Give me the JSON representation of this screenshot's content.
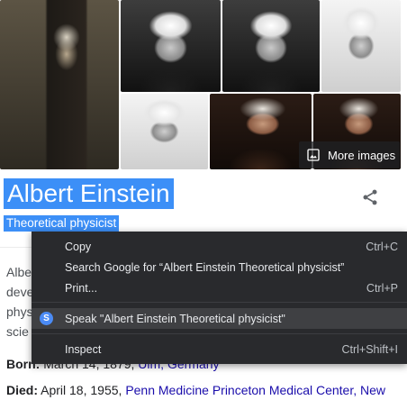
{
  "images": {
    "more_images_label": "More images",
    "more_images_icon": "image-icon"
  },
  "entity": {
    "title": "Albert Einstein",
    "subtitle": "Theoretical physicist",
    "share_icon": "share-icon"
  },
  "description": {
    "lines": [
      "Albe",
      "deve",
      "phys",
      "scie"
    ]
  },
  "facts": {
    "born": {
      "label": "Born:",
      "text": "March 14, 1879,",
      "link": "Ulm, Germany"
    },
    "died": {
      "label": "Died:",
      "text": "April 18, 1955,",
      "link": "Penn Medicine Princeton Medical Center, New"
    }
  },
  "context_menu": {
    "copy": {
      "label": "Copy",
      "shortcut": "Ctrl+C"
    },
    "search": {
      "label": "Search Google for “Albert Einstein Theoretical physicist”"
    },
    "print": {
      "label": "Print...",
      "shortcut": "Ctrl+P"
    },
    "speak": {
      "label": "Speak \"Albert Einstein Theoretical physicist\"",
      "icon": "speak-extension-icon"
    },
    "inspect": {
      "label": "Inspect",
      "shortcut": "Ctrl+Shift+I"
    }
  },
  "colors": {
    "selection": "#3c8ff7",
    "menu_bg": "#292a2d",
    "link": "#1a0dab"
  }
}
